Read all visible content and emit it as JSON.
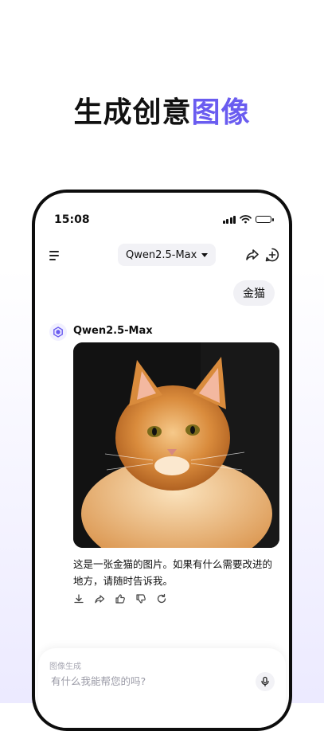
{
  "headline": {
    "prefix": "生成创意",
    "accent": "图像",
    "accent_color": "#6a5cf0"
  },
  "status_bar": {
    "time": "15:08",
    "icons": [
      "signal-icon",
      "wifi-icon",
      "battery-icon"
    ]
  },
  "header": {
    "model_name": "Qwen2.5-Max",
    "left_icon": "menu-icon",
    "right_icons": [
      "share-icon",
      "new-chat-icon"
    ]
  },
  "chat": {
    "user_message": "金猫",
    "bot": {
      "name": "Qwen2.5-Max",
      "image_icon": "cat-image",
      "reply": "这是一张金猫的图片。如果有什么需要改进的地方，请随时告诉我。",
      "actions": [
        "download-icon",
        "share-icon",
        "thumbs-up-icon",
        "thumbs-down-icon",
        "regenerate-icon"
      ]
    }
  },
  "composer": {
    "mode_label": "图像生成",
    "placeholder": "有什么我能帮您的吗?",
    "mic_icon": "microphone-icon"
  }
}
